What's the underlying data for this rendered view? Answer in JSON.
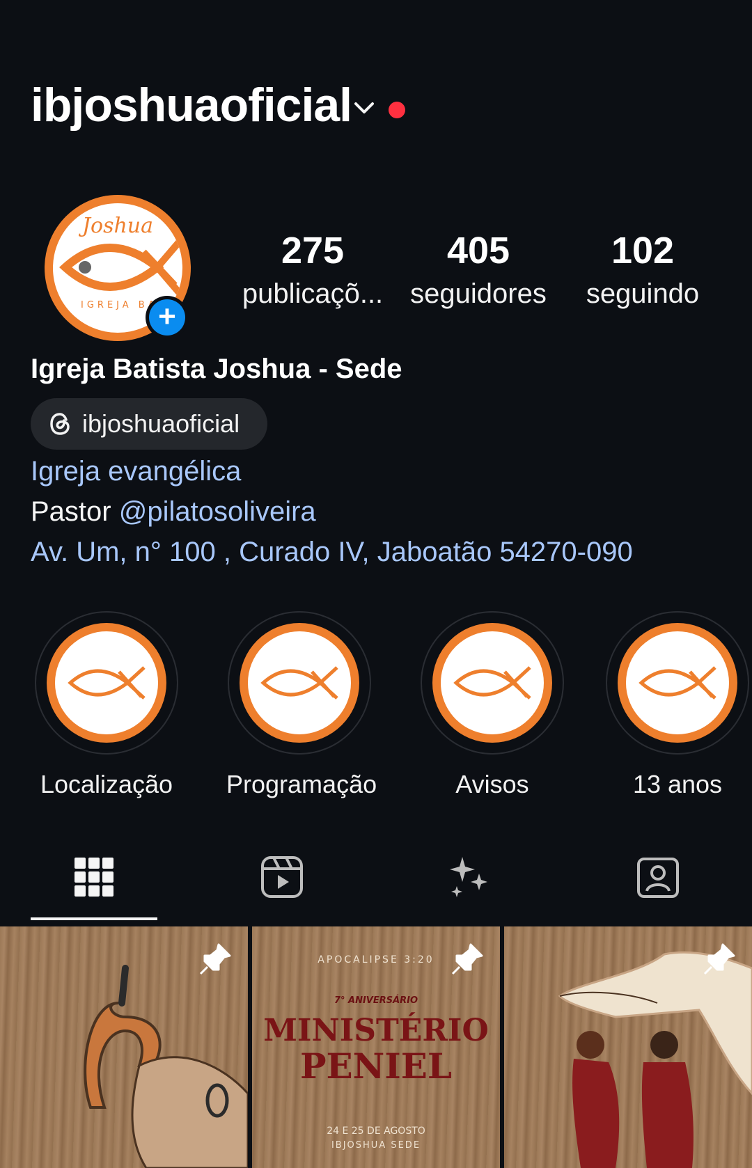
{
  "header": {
    "username": "ibjoshuaoficial"
  },
  "profile": {
    "avatar_text_top": "Joshua",
    "avatar_text_bottom": "IGREJA BATISTA",
    "stats": [
      {
        "value": "275",
        "label": "publicaçõ..."
      },
      {
        "value": "405",
        "label": "seguidores"
      },
      {
        "value": "102",
        "label": "seguindo"
      }
    ],
    "full_name": "Igreja Batista Joshua - Sede",
    "threads_handle": "ibjoshuaoficial",
    "category": "Igreja evangélica",
    "bio_prefix": "Pastor ",
    "bio_mention": "@pilatosoliveira",
    "address": "Av. Um, n° 100 , Curado IV, Jaboatão 54270-090"
  },
  "highlights": [
    {
      "label": "Localização"
    },
    {
      "label": "Programação"
    },
    {
      "label": "Avisos"
    },
    {
      "label": "13 anos"
    }
  ],
  "tabs": [
    "grid-icon",
    "reels-icon",
    "sparkles-icon",
    "tagged-icon"
  ],
  "posts": [
    {
      "kind": "illustration"
    },
    {
      "top_text": "APOCALIPSE 3:20",
      "subtitle": "7° ANIVERSÁRIO",
      "title_line1": "MINISTÉRIO",
      "title_line2": "PENIEL",
      "date_line": "24 E 25 DE AGOSTO",
      "place_line": "IBJOSHUA SEDE"
    },
    {
      "kind": "illustration"
    }
  ],
  "colors": {
    "background": "#0c0f14",
    "accent": "#ee7f2d",
    "link": "#a8c7fa",
    "notification": "#ff3040",
    "add": "#0a8cf0"
  }
}
